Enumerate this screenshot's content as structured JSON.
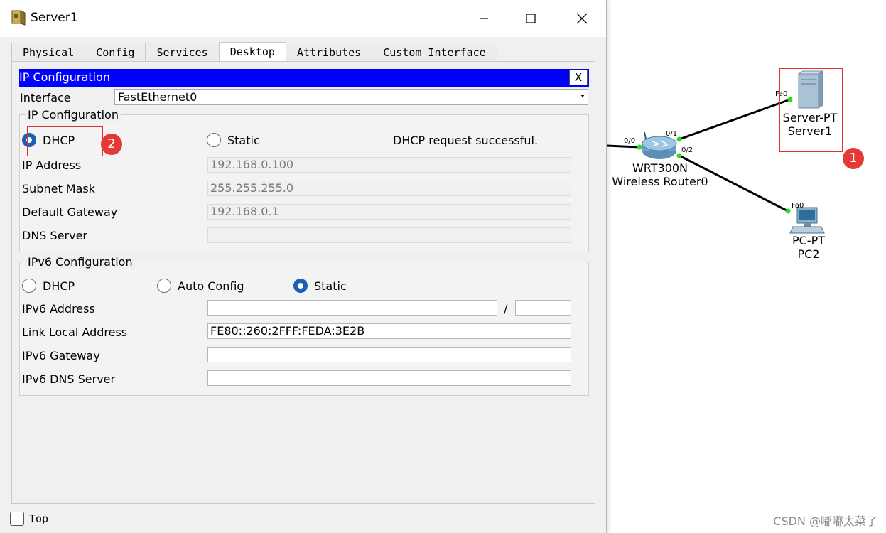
{
  "window": {
    "title": "Server1",
    "controls": {
      "minimize": "minimize",
      "maximize": "maximize",
      "close": "close"
    }
  },
  "tabs": [
    "Physical",
    "Config",
    "Services",
    "Desktop",
    "Attributes",
    "Custom Interface"
  ],
  "active_tab": "Desktop",
  "panel": {
    "title": "IP Configuration",
    "close_label": "X",
    "interface_label": "Interface",
    "interface_value": "FastEthernet0"
  },
  "ipv4": {
    "legend": "IP Configuration",
    "mode_dhcp": "DHCP",
    "mode_static": "Static",
    "selected_mode": "DHCP",
    "status": "DHCP request successful.",
    "ip_label": "IP Address",
    "ip_value": "192.168.0.100",
    "mask_label": "Subnet Mask",
    "mask_value": "255.255.255.0",
    "gateway_label": "Default Gateway",
    "gateway_value": "192.168.0.1",
    "dns_label": "DNS Server",
    "dns_value": ""
  },
  "ipv6": {
    "legend": "IPv6 Configuration",
    "mode_dhcp": "DHCP",
    "mode_auto": "Auto Config",
    "mode_static": "Static",
    "selected_mode": "Static",
    "addr_label": "IPv6 Address",
    "addr_value": "",
    "slash": "/",
    "prefix_value": "",
    "link_local_label": "Link Local Address",
    "link_local_value": "FE80::260:2FFF:FEDA:3E2B",
    "gateway_label": "IPv6 Gateway",
    "gateway_value": "",
    "dns_label": "IPv6 DNS Server",
    "dns_value": ""
  },
  "footer": {
    "top_label": "Top",
    "top_checked": false
  },
  "annotations": {
    "badge_1": "1",
    "badge_2": "2"
  },
  "topology": {
    "router": {
      "model": "WRT300N",
      "name": "Wireless Router0",
      "ports": [
        "0/0",
        "0/1",
        "0/2"
      ]
    },
    "server": {
      "model": "Server-PT",
      "name": "Server1",
      "port": "Fa0"
    },
    "pc": {
      "model": "PC-PT",
      "name": "PC2",
      "port": "Fa0"
    }
  },
  "watermark": "CSDN @嘟嘟太菜了",
  "colors": {
    "header_blue": "#0000ff",
    "radio_blue": "#1a5fb4",
    "link_green": "#22dd22",
    "annotation_red": "#e53935"
  }
}
